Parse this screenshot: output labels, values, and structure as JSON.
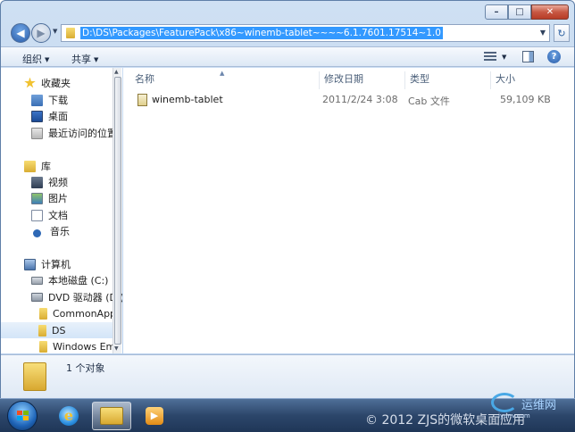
{
  "window": {
    "caption_buttons": {
      "minimize": "–",
      "maximize": "□",
      "close": "✕"
    }
  },
  "address_bar": {
    "path": "D:\\DS\\Packages\\FeaturePack\\x86~winemb-tablet~~~~6.1.7601.17514~1.0",
    "dropdown_icon": "chevron-down-icon",
    "refresh_icon": "refresh-icon"
  },
  "toolbar": {
    "organize_label": "组织",
    "share_label": "共享"
  },
  "nav": {
    "favorites_header": "收藏夹",
    "favorites": [
      {
        "label": "下载",
        "icon": "download-icon"
      },
      {
        "label": "桌面",
        "icon": "desktop-icon"
      },
      {
        "label": "最近访问的位置",
        "icon": "recent-places-icon"
      }
    ],
    "libraries_header": "库",
    "libraries": [
      {
        "label": "视频",
        "icon": "video-icon"
      },
      {
        "label": "图片",
        "icon": "picture-icon"
      },
      {
        "label": "文档",
        "icon": "document-icon"
      },
      {
        "label": "音乐",
        "icon": "music-icon"
      }
    ],
    "computer_header": "计算机",
    "computer": [
      {
        "label": "本地磁盘 (C:)",
        "icon": "disk-icon"
      },
      {
        "label": "DVD 驱动器 (D:)",
        "icon": "dvd-icon"
      },
      {
        "label": "CommonAppl",
        "icon": "folder-icon"
      },
      {
        "label": "DS",
        "icon": "folder-icon"
      },
      {
        "label": "Windows Emb",
        "icon": "folder-icon"
      }
    ]
  },
  "columns": {
    "name": "名称",
    "modified": "修改日期",
    "type": "类型",
    "size": "大小"
  },
  "files": [
    {
      "name": "winemb-tablet",
      "modified": "2011/2/24 3:08",
      "type": "Cab 文件",
      "size": "59,109 KB"
    }
  ],
  "details": {
    "count_text": "1 个对象"
  },
  "taskbar": {
    "watermark": "© 2012 ZJS的微软桌面应用",
    "logo_text": "运维网",
    "logo_sub": "iyunv.com"
  }
}
